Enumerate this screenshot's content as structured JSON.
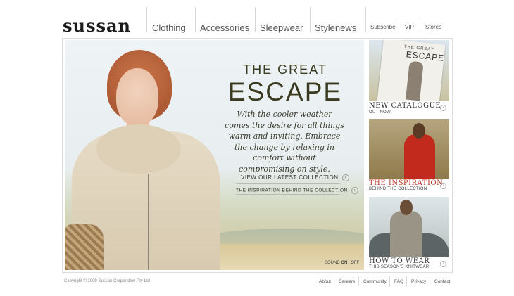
{
  "header": {
    "logo": "sussan",
    "nav_main": [
      "Clothing",
      "Accessories",
      "Sleepwear",
      "Stylenews"
    ],
    "nav_util": [
      "Subscribe",
      "VIP",
      "Stores"
    ]
  },
  "hero": {
    "title_line1": "THE GREAT",
    "title_line2": "ESCAPE",
    "copy": "With the cooler weather comes the desire for all things warm and inviting. Embrace the change by relaxing in comfort without compromising on style.",
    "cta_primary": "VIEW OUR LATEST COLLECTION",
    "cta_secondary": "THE INSPIRATION BEHIND THE COLLECTION",
    "sound_label": "SOUND",
    "sound_on": "ON",
    "sound_sep": "|",
    "sound_off": "OFF"
  },
  "side_panels": [
    {
      "title": "NEW CATALOGUE",
      "subtitle": "OUT NOW",
      "card_line1": "THE GREAT",
      "card_line2": "ESCAPE",
      "title_color": "#333333"
    },
    {
      "title": "THE INSPIRATION",
      "subtitle": "BEHIND THE COLLECTION",
      "title_color": "#c0392b"
    },
    {
      "title": "HOW TO WEAR",
      "subtitle": "THIS SEASON'S KNITWEAR",
      "title_color": "#333333"
    }
  ],
  "footer": {
    "copyright": "Copyright © 2009 Sussan Corporation Pty Ltd",
    "links": [
      "About",
      "Careers",
      "Community",
      "FAQ",
      "Privacy",
      "Contact"
    ]
  },
  "icons": {
    "arrow": "circle-arrow-icon"
  }
}
